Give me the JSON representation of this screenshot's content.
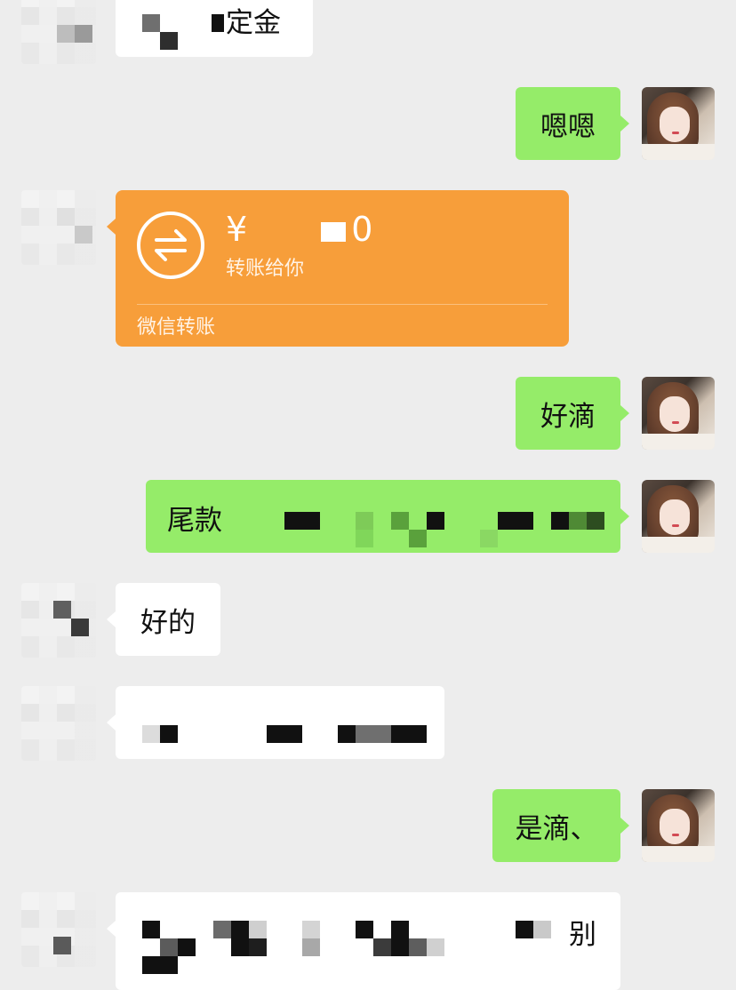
{
  "messages": [
    {
      "side": "left",
      "type": "text",
      "text": "定金"
    },
    {
      "side": "right",
      "type": "text",
      "text": "嗯嗯"
    },
    {
      "side": "left",
      "type": "transfer",
      "amount": "¥",
      "amount_suffix": "0",
      "caption": "转账给你",
      "footer": "微信转账"
    },
    {
      "side": "right",
      "type": "text",
      "text": "好滴"
    },
    {
      "side": "right",
      "type": "text",
      "text": "尾款"
    },
    {
      "side": "left",
      "type": "text",
      "text": "好的"
    },
    {
      "side": "left",
      "type": "text",
      "text": ""
    },
    {
      "side": "right",
      "type": "text",
      "text": "是滴、"
    },
    {
      "side": "left",
      "type": "text",
      "text": "别"
    }
  ],
  "icons": {
    "transfer": "transfer-arrows-icon"
  },
  "colors": {
    "background": "#ededed",
    "sent_bubble": "#95ec69",
    "received_bubble": "#ffffff",
    "transfer_card": "#f79e3a"
  }
}
